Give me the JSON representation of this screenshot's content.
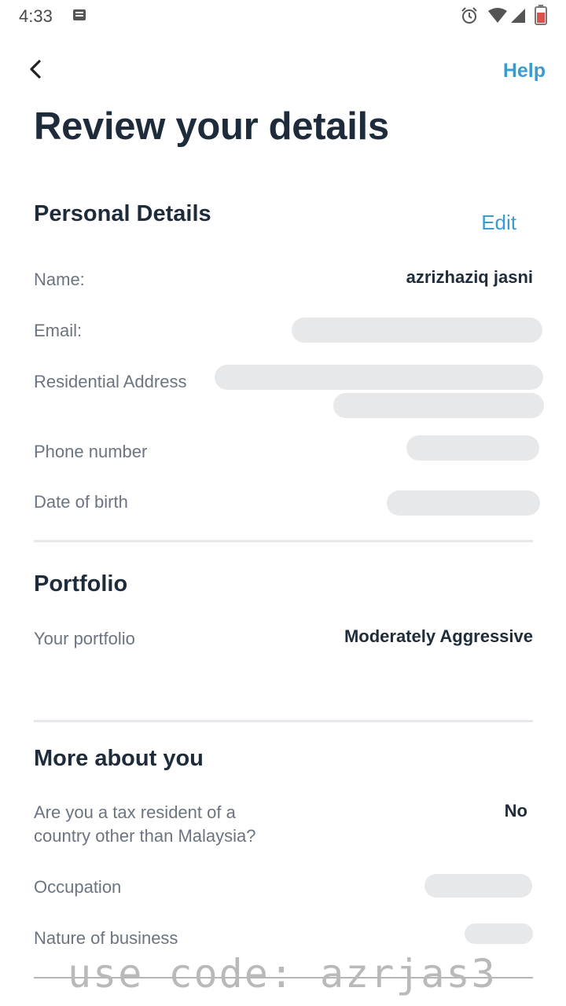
{
  "status_bar": {
    "time": "4:33",
    "icons": [
      "notification-note-icon",
      "alarm-icon",
      "wifi-icon",
      "signal-icon",
      "battery-icon"
    ]
  },
  "header": {
    "back_icon": "chevron-left-icon",
    "help_label": "Help",
    "title": "Review your details"
  },
  "personal": {
    "title": "Personal Details",
    "edit_label": "Edit",
    "name_label": "Name:",
    "name_value": "azrizhaziq  jasni",
    "email_label": "Email:",
    "address_label": "Residential Address",
    "phone_label": "Phone number",
    "dob_label": "Date of birth"
  },
  "portfolio": {
    "title": "Portfolio",
    "label": "Your portfolio",
    "value": "Moderately Aggressive"
  },
  "more": {
    "title": "More about you",
    "tax_label_line1": "Are you a tax resident of a",
    "tax_label_line2": "country other than Malaysia?",
    "tax_value": "No",
    "occupation_label": "Occupation",
    "business_label": "Nature of business"
  },
  "watermark": "use code: azrjas3",
  "colors": {
    "accent": "#3a9bd1",
    "heading": "#1d2b3a",
    "label": "#6b7480",
    "redacted": "#e7e8ea"
  }
}
